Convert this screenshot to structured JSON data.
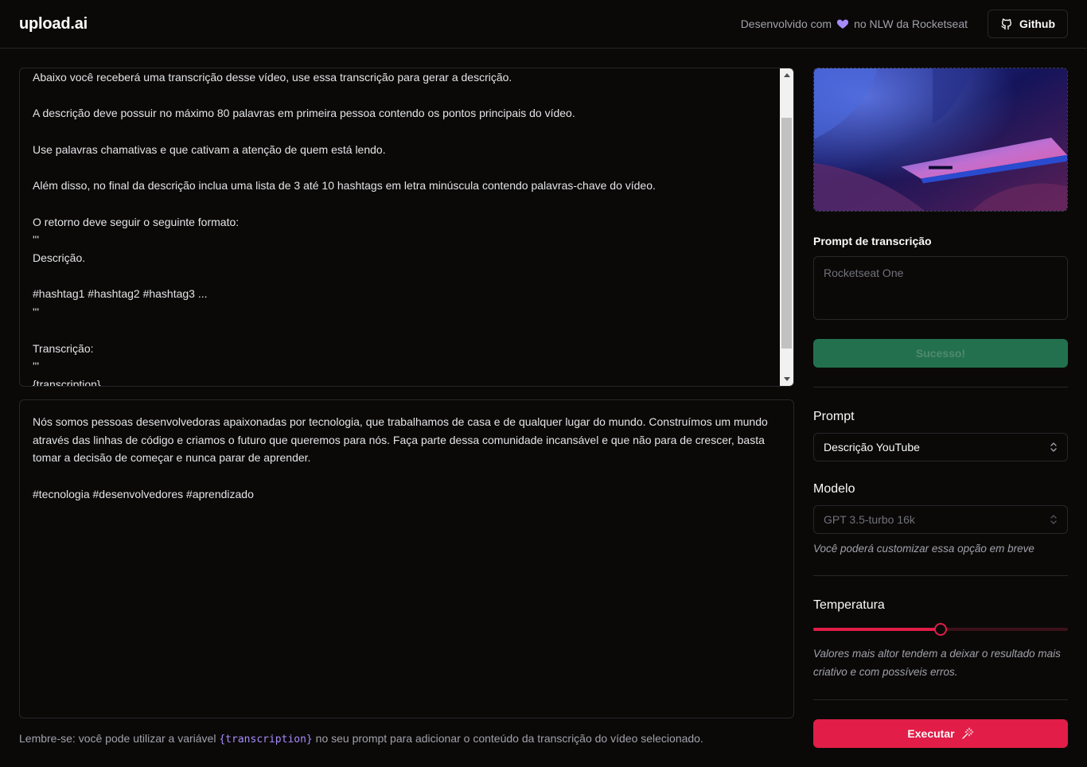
{
  "header": {
    "logo": "upload.ai",
    "credit_prefix": "Desenvolvido com",
    "credit_suffix": "no NLW da Rocketseat",
    "github_label": "Github"
  },
  "prompt_editor": {
    "text": "Abaixo você receberá uma transcrição desse vídeo, use essa transcrição para gerar a descrição.\n\nA descrição deve possuir no máximo 80 palavras em primeira pessoa contendo os pontos principais do vídeo.\n\nUse palavras chamativas e que cativam a atenção de quem está lendo.\n\nAlém disso, no final da descrição inclua uma lista de 3 até 10 hashtags em letra minúscula contendo palavras-chave do vídeo.\n\nO retorno deve seguir o seguinte formato:\n'''\nDescrição.\n\n#hashtag1 #hashtag2 #hashtag3 ...\n'''\n\nTranscrição:\n'''\n{transcription}"
  },
  "result": {
    "text": "Nós somos pessoas desenvolvedoras apaixonadas por tecnologia, que trabalhamos de casa e de qualquer lugar do mundo. Construímos um mundo através das linhas de código e criamos o futuro que queremos para nós. Faça parte dessa comunidade incansável e que não para de crescer, basta tomar a decisão de começar e nunca parar de aprender.\n\n#tecnologia #desenvolvedores #aprendizado"
  },
  "hint": {
    "prefix": "Lembre-se: você pode utilizar a variável",
    "variable": "{transcription}",
    "suffix": "no seu prompt para adicionar o conteúdo da transcrição do vídeo selecionado."
  },
  "sidebar": {
    "transcription_label": "Prompt de transcrição",
    "transcription_placeholder": "Rocketseat One",
    "success_label": "Sucesso!",
    "prompt_label": "Prompt",
    "prompt_selected": "Descrição YouTube",
    "model_label": "Modelo",
    "model_selected": "GPT 3.5-turbo 16k",
    "model_note": "Você poderá customizar essa opção em breve",
    "temperature_label": "Temperatura",
    "temperature_value": 0.5,
    "temperature_note": "Valores mais altor tendem a deixar o resultado mais criativo e com possíveis erros.",
    "execute_label": "Executar"
  },
  "colors": {
    "accent": "#e11d48",
    "success": "#23704f",
    "heart": "#a78bfa",
    "variable": "#a78bfa"
  }
}
